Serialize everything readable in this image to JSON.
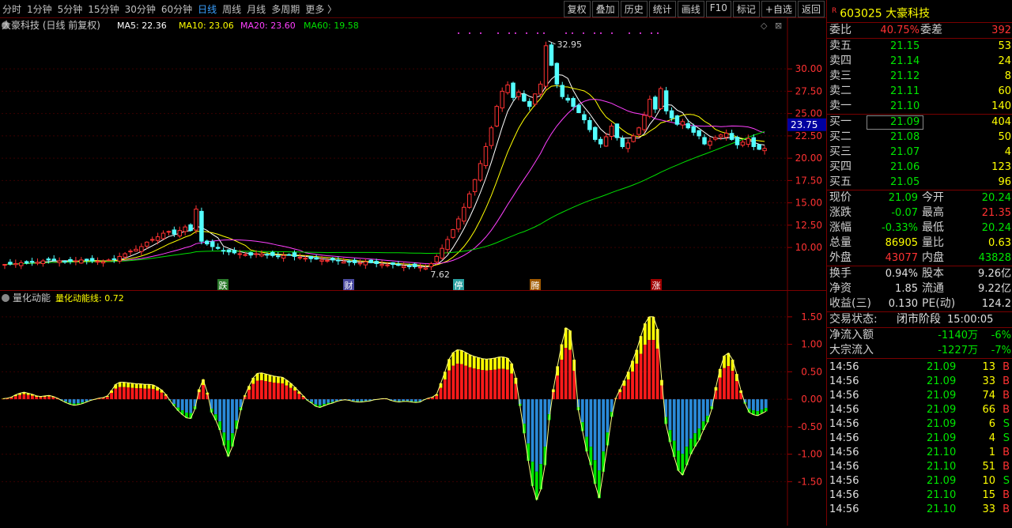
{
  "toolbar": {
    "periods": [
      "分时",
      "1分钟",
      "5分钟",
      "15分钟",
      "30分钟",
      "60分钟",
      "日线",
      "周线",
      "月线",
      "多周期",
      "更多"
    ],
    "active_period": "日线",
    "tools": [
      "复权",
      "叠加",
      "历史",
      "统计",
      "画线",
      "F10",
      "标记",
      "+自选",
      "返回"
    ]
  },
  "main": {
    "title": "大豪科技 (日线 前复权)",
    "ma": [
      {
        "label": "MA5: 22.36",
        "color": "#ffffff"
      },
      {
        "label": "MA10: 23.06",
        "color": "#ffff00"
      },
      {
        "label": "MA20: 23.60",
        "color": "#ff40ff"
      },
      {
        "label": "MA60: 19.58",
        "color": "#00e000"
      }
    ],
    "high_label": "32.95",
    "low_label": "7.62",
    "price_tag": "23.75",
    "events": [
      "跌",
      "财",
      "停",
      "腾",
      "涨"
    ],
    "colors": {
      "up": "#ff3232",
      "down": "#54ffff"
    }
  },
  "sub": {
    "title": "量化动能",
    "line_label": "量化动能线: 0.72"
  },
  "chart_data": [
    {
      "type": "candlestick",
      "title": "大豪科技 (日线 前复权)",
      "yticks": [
        10.0,
        12.5,
        15.0,
        17.5,
        20.0,
        22.5,
        25.0,
        27.5,
        30.0
      ],
      "ylim": [
        7.0,
        34.0
      ],
      "closes": [
        8.1,
        8.15,
        8.2,
        8.3,
        8.25,
        8.4,
        8.35,
        8.5,
        8.6,
        8.55,
        8.5,
        8.4,
        8.45,
        8.5,
        8.6,
        8.55,
        8.5,
        8.45,
        8.4,
        8.6,
        8.7,
        9.0,
        9.3,
        9.6,
        9.8,
        10.1,
        10.6,
        10.9,
        11.2,
        11.6,
        11.8,
        11.5,
        11.9,
        12.3,
        11.9,
        14.3,
        10.7,
        10.4,
        10.1,
        9.9,
        9.6,
        9.5,
        9.4,
        9.3,
        9.2,
        9.15,
        9.3,
        9.25,
        9.2,
        9.1,
        9.05,
        9.1,
        9.2,
        9.0,
        8.9,
        8.8,
        8.75,
        8.7,
        8.6,
        8.55,
        8.6,
        8.5,
        8.4,
        8.35,
        8.3,
        8.25,
        8.4,
        8.3,
        8.2,
        8.1,
        8.05,
        8.1,
        8.0,
        7.9,
        7.9,
        7.85,
        7.8,
        7.7,
        8.2,
        9.0,
        9.9,
        10.9,
        12.0,
        13.2,
        14.5,
        16.0,
        17.6,
        19.4,
        21.3,
        23.4,
        25.8,
        27.5,
        28.2,
        26.8,
        27.4,
        26.4,
        25.8,
        27.2,
        28.3,
        32.6,
        30.4,
        28.3,
        26.9,
        26.5,
        25.8,
        25.1,
        24.3,
        23.2,
        22.1,
        21.6,
        22.4,
        23.6,
        22.3,
        21.3,
        21.7,
        22.5,
        23.4,
        24.8,
        26.6,
        25.5,
        27.8,
        25.3,
        24.5,
        23.8,
        24.1,
        23.4,
        22.9,
        22.5,
        21.6,
        21.9,
        22.3,
        22.6,
        22.8,
        22.1,
        21.5,
        21.8,
        22.2,
        21.3,
        21.0,
        21.09
      ],
      "ma_series": [
        "MA5",
        "MA10",
        "MA20",
        "MA60"
      ]
    },
    {
      "type": "bar",
      "title": "量化动能",
      "yticks": [
        -1.5,
        -1.0,
        -0.5,
        0.0,
        0.5,
        1.0,
        1.5
      ],
      "ylim": [
        -2.2,
        1.8
      ],
      "series_name": "量化动能线",
      "values": [
        0.01,
        0.02,
        0.04,
        0.08,
        0.11,
        0.13,
        0.11,
        0.09,
        0.06,
        0.05,
        0.06,
        0.07,
        0.05,
        0.02,
        -0.02,
        -0.06,
        -0.09,
        -0.11,
        -0.1,
        -0.08,
        -0.05,
        -0.02,
        0.0,
        0.02,
        0.03,
        0.06,
        0.16,
        0.27,
        0.31,
        0.31,
        0.3,
        0.29,
        0.28,
        0.28,
        0.27,
        0.27,
        0.26,
        0.22,
        0.17,
        0.09,
        -0.02,
        -0.12,
        -0.21,
        -0.28,
        -0.34,
        -0.35,
        -0.18,
        0.18,
        0.36,
        0.12,
        -0.24,
        -0.38,
        -0.56,
        -0.84,
        -1.04,
        -0.86,
        -0.54,
        -0.2,
        0.07,
        0.24,
        0.39,
        0.47,
        0.48,
        0.46,
        0.44,
        0.42,
        0.41,
        0.4,
        0.35,
        0.29,
        0.22,
        0.14,
        0.06,
        -0.02,
        -0.07,
        -0.13,
        -0.15,
        -0.12,
        -0.09,
        -0.07,
        -0.04,
        -0.02,
        -0.01,
        -0.02,
        -0.04,
        -0.05,
        -0.05,
        -0.04,
        -0.03,
        -0.01,
        0.0,
        0.01,
        0.01,
        -0.02,
        -0.04,
        -0.05,
        -0.04,
        -0.04,
        -0.05,
        -0.06,
        -0.05,
        -0.01,
        0.02,
        0.04,
        0.09,
        0.29,
        0.5,
        0.73,
        0.85,
        0.9,
        0.89,
        0.85,
        0.81,
        0.78,
        0.76,
        0.74,
        0.73,
        0.74,
        0.75,
        0.77,
        0.77,
        0.75,
        0.65,
        0.39,
        -0.12,
        -0.62,
        -1.12,
        -1.58,
        -1.83,
        -1.64,
        -1.2,
        -0.38,
        0.18,
        0.6,
        1.0,
        1.3,
        1.25,
        0.72,
        -0.2,
        -0.58,
        -0.95,
        -1.2,
        -1.54,
        -1.8,
        -1.32,
        -0.84,
        -0.32,
        0.02,
        0.18,
        0.34,
        0.5,
        0.7,
        0.9,
        1.15,
        1.38,
        1.5,
        1.5,
        1.28,
        0.35,
        -0.45,
        -0.78,
        -1.05,
        -1.3,
        -1.38,
        -1.2,
        -1.0,
        -0.86,
        -0.74,
        -0.56,
        -0.42,
        -0.18,
        0.22,
        0.55,
        0.79,
        0.84,
        0.72,
        0.46,
        0.16,
        -0.08,
        -0.24,
        -0.28,
        -0.3,
        -0.26,
        -0.22
      ]
    }
  ],
  "right": {
    "code": "603025",
    "name": "大豪科技",
    "weibi": {
      "label": "委比",
      "value": "40.75%",
      "label2": "委差",
      "value2": "392"
    },
    "asks": [
      {
        "label": "卖五",
        "price": "21.15",
        "vol": "53"
      },
      {
        "label": "卖四",
        "price": "21.14",
        "vol": "24"
      },
      {
        "label": "卖三",
        "price": "21.12",
        "vol": "8"
      },
      {
        "label": "卖二",
        "price": "21.11",
        "vol": "60"
      },
      {
        "label": "卖一",
        "price": "21.10",
        "vol": "140"
      }
    ],
    "bids": [
      {
        "label": "买一",
        "price": "21.09",
        "vol": "404"
      },
      {
        "label": "买二",
        "price": "21.08",
        "vol": "50"
      },
      {
        "label": "买三",
        "price": "21.07",
        "vol": "4"
      },
      {
        "label": "买四",
        "price": "21.06",
        "vol": "123"
      },
      {
        "label": "买五",
        "price": "21.05",
        "vol": "96"
      }
    ],
    "quote": [
      {
        "l1": "现价",
        "v1": "21.09",
        "c1": "green",
        "l2": "今开",
        "v2": "20.24",
        "c2": "green"
      },
      {
        "l1": "涨跌",
        "v1": "-0.07",
        "c1": "green",
        "l2": "最高",
        "v2": "21.35",
        "c2": "red"
      },
      {
        "l1": "涨幅",
        "v1": "-0.33%",
        "c1": "green",
        "l2": "最低",
        "v2": "20.24",
        "c2": "green"
      },
      {
        "l1": "总量",
        "v1": "86905",
        "c1": "yellow",
        "l2": "量比",
        "v2": "0.63",
        "c2": "yellow"
      },
      {
        "l1": "外盘",
        "v1": "43077",
        "c1": "red",
        "l2": "内盘",
        "v2": "43828",
        "c2": "green"
      }
    ],
    "fin": [
      {
        "l1": "换手",
        "v1": "0.94%",
        "l2": "股本",
        "v2": "9.26亿"
      },
      {
        "l1": "净资",
        "v1": "1.85",
        "l2": "流通",
        "v2": "9.22亿"
      },
      {
        "l1": "收益(三)",
        "v1": "0.130",
        "l2": "PE(动)",
        "v2": "124.2"
      }
    ],
    "status": {
      "label": "交易状态:",
      "value": "闭市阶段",
      "time": "15:00:05"
    },
    "flow": [
      {
        "label": "净流入额",
        "amount": "-1140万",
        "pct": "-6%"
      },
      {
        "label": "大宗流入",
        "amount": "-1227万",
        "pct": "-7%"
      }
    ],
    "ticks": [
      {
        "t": "14:56",
        "p": "21.09",
        "c": "green",
        "v": "13",
        "bs": "B",
        "bc": "red"
      },
      {
        "t": "14:56",
        "p": "21.09",
        "c": "green",
        "v": "33",
        "bs": "B",
        "bc": "red"
      },
      {
        "t": "14:56",
        "p": "21.09",
        "c": "green",
        "v": "74",
        "bs": "B",
        "bc": "red"
      },
      {
        "t": "14:56",
        "p": "21.09",
        "c": "green",
        "v": "66",
        "bs": "B",
        "bc": "red"
      },
      {
        "t": "14:56",
        "p": "21.09",
        "c": "green",
        "v": "6",
        "bs": "S",
        "bc": "green"
      },
      {
        "t": "14:56",
        "p": "21.09",
        "c": "green",
        "v": "4",
        "bs": "S",
        "bc": "green"
      },
      {
        "t": "14:56",
        "p": "21.10",
        "c": "green",
        "v": "1",
        "bs": "B",
        "bc": "red"
      },
      {
        "t": "14:56",
        "p": "21.10",
        "c": "green",
        "v": "51",
        "bs": "B",
        "bc": "red"
      },
      {
        "t": "14:56",
        "p": "21.09",
        "c": "green",
        "v": "10",
        "bs": "S",
        "bc": "green"
      },
      {
        "t": "14:56",
        "p": "21.10",
        "c": "green",
        "v": "15",
        "bs": "B",
        "bc": "red"
      },
      {
        "t": "14:56",
        "p": "21.10",
        "c": "green",
        "v": "33",
        "bs": "B",
        "bc": "red"
      }
    ]
  }
}
